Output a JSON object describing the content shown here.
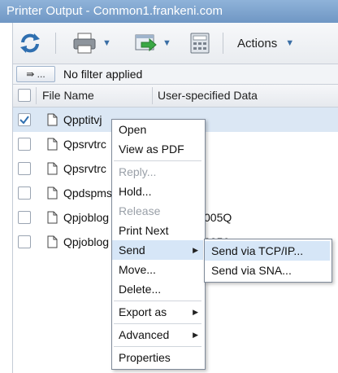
{
  "window": {
    "title": "Printer Output - Common1.frankeni.com"
  },
  "toolbar": {
    "refresh_icon": "refresh-icon",
    "print_icon": "printer-icon",
    "export_icon": "export-icon",
    "calculator_icon": "calculator-icon",
    "actions_label": "Actions"
  },
  "filter": {
    "button_label": "⇛ ...",
    "text": "No filter applied"
  },
  "columns": {
    "file_name": "File Name",
    "user_data": "User-specified Data"
  },
  "rows": [
    {
      "name": "Qpptitvj",
      "user_data": "",
      "checked": true
    },
    {
      "name": "Qpsrvtrc",
      "user_data": "",
      "checked": false
    },
    {
      "name": "Qpsrvtrc",
      "user_data": "",
      "checked": false
    },
    {
      "name": "Qpdspms",
      "user_data": "",
      "checked": false
    },
    {
      "name": "Qpjoblog",
      "user_data": "005Q",
      "checked": false
    },
    {
      "name": "Qpjoblog",
      "user_data": "0056",
      "checked": false
    }
  ],
  "context_menu": {
    "items": [
      {
        "label": "Open",
        "enabled": true
      },
      {
        "label": "View as PDF",
        "enabled": true
      },
      {
        "label": "Reply...",
        "enabled": false
      },
      {
        "label": "Hold...",
        "enabled": true
      },
      {
        "label": "Release",
        "enabled": false
      },
      {
        "label": "Print Next",
        "enabled": true
      },
      {
        "label": "Send",
        "enabled": true,
        "highlighted": true,
        "submenu": true
      },
      {
        "label": "Move...",
        "enabled": true
      },
      {
        "label": "Delete...",
        "enabled": true
      },
      {
        "label": "Export as",
        "enabled": true,
        "submenu": true
      },
      {
        "label": "Advanced",
        "enabled": true,
        "submenu": true
      },
      {
        "label": "Properties",
        "enabled": true
      }
    ]
  },
  "submenu": {
    "items": [
      {
        "label": "Send via TCP/IP...",
        "highlighted": true
      },
      {
        "label": "Send via SNA..."
      }
    ]
  },
  "colors": {
    "accent": "#3a6ea5",
    "highlight": "#d6e6f7",
    "selected_row": "#dbe7f4"
  }
}
